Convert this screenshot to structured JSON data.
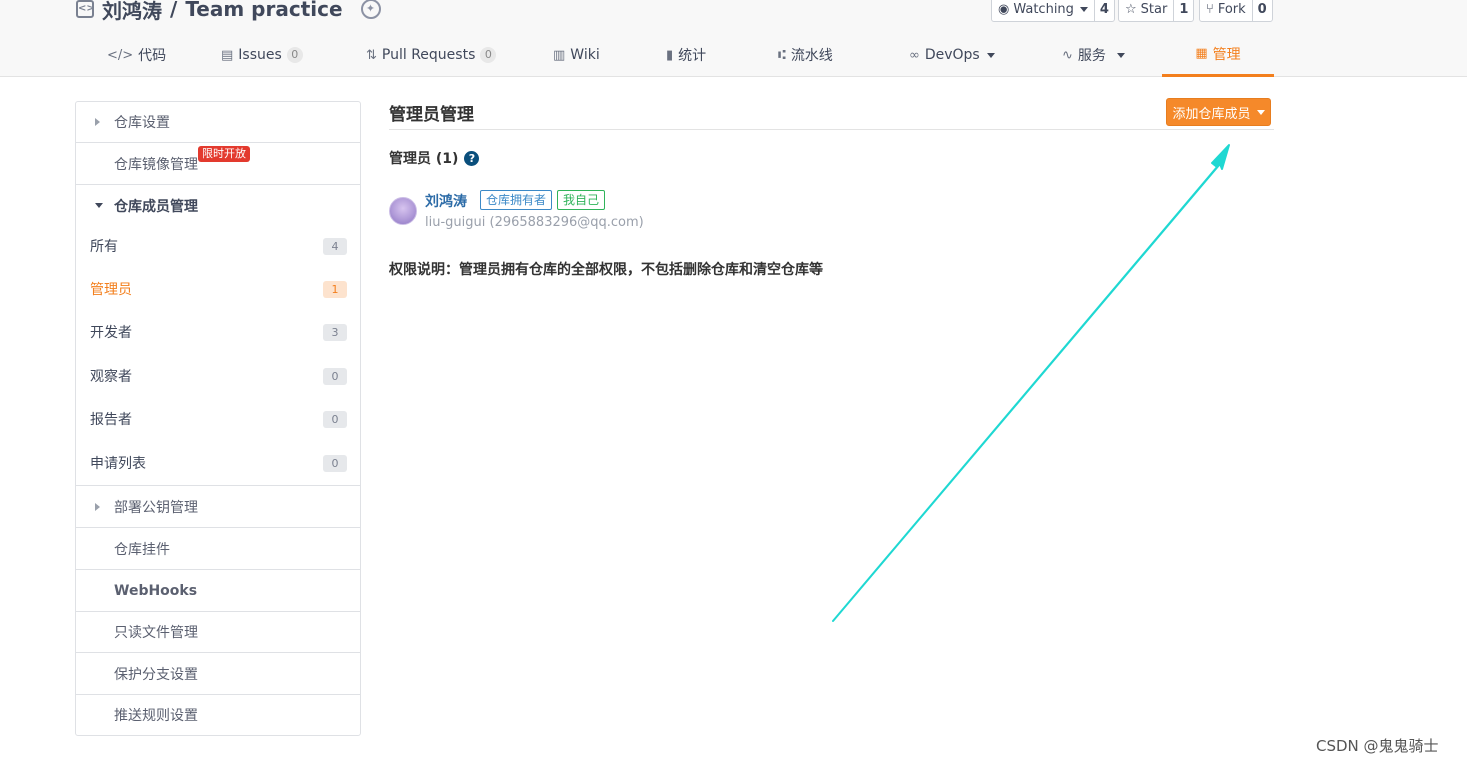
{
  "repo": {
    "owner": "刘鸿涛",
    "separator": "/",
    "name": "Team practice"
  },
  "actions": {
    "watch": {
      "label": "Watching",
      "count": "4"
    },
    "star": {
      "label": "Star",
      "count": "1"
    },
    "fork": {
      "label": "Fork",
      "count": "0"
    }
  },
  "nav": {
    "code": "代码",
    "issues": "Issues",
    "issues_count": "0",
    "pulls": "Pull Requests",
    "pulls_count": "0",
    "wiki": "Wiki",
    "stats": "统计",
    "pipeline": "流水线",
    "devops": "DevOps",
    "services": "服务",
    "manage": "管理"
  },
  "sidebar": {
    "repo_settings": "仓库设置",
    "mirror": "仓库镜像管理",
    "mirror_badge": "限时开放",
    "members": "仓库成员管理",
    "sub": [
      {
        "label": "所有",
        "count": "4"
      },
      {
        "label": "管理员",
        "count": "1"
      },
      {
        "label": "开发者",
        "count": "3"
      },
      {
        "label": "观察者",
        "count": "0"
      },
      {
        "label": "报告者",
        "count": "0"
      },
      {
        "label": "申请列表",
        "count": "0"
      }
    ],
    "deploy_keys": "部署公钥管理",
    "hooks": "仓库挂件",
    "webhooks": "WebHooks",
    "readonly": "只读文件管理",
    "protected": "保护分支设置",
    "push_rules": "推送规则设置"
  },
  "main": {
    "title": "管理员管理",
    "add_button": "添加仓库成员",
    "section": "管理员 (1)",
    "member": {
      "name": "刘鸿涛",
      "tag_owner": "仓库拥有者",
      "tag_self": "我自己",
      "sub": "liu-guigui (2965883296@qq.com)"
    },
    "note": "权限说明：管理员拥有仓库的全部权限，不包括删除仓库和清空仓库等"
  },
  "watermark": "CSDN @鬼鬼骑士",
  "colors": {
    "accent": "#f37f1d",
    "annotation_arrow": "#1fd8d2"
  }
}
